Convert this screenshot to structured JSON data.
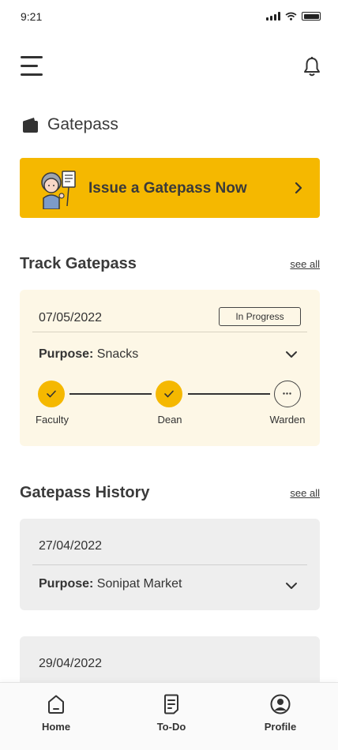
{
  "status_bar": {
    "time": "9:21"
  },
  "page": {
    "title": "Gatepass"
  },
  "issue_banner": {
    "label": "Issue a Gatepass Now"
  },
  "track": {
    "heading": "Track Gatepass",
    "see_all": "see all",
    "card": {
      "date": "07/05/2022",
      "status": "In Progress",
      "purpose_label": "Purpose:",
      "purpose_value": "Snacks",
      "steps": [
        {
          "label": "Faculty",
          "state": "done"
        },
        {
          "label": "Dean",
          "state": "done"
        },
        {
          "label": "Warden",
          "state": "pending"
        }
      ]
    }
  },
  "history": {
    "heading": "Gatepass History",
    "see_all": "see all",
    "items": [
      {
        "date": "27/04/2022",
        "purpose_label": "Purpose:",
        "purpose_value": "Sonipat Market"
      },
      {
        "date": "29/04/2022"
      }
    ]
  },
  "bottom_nav": {
    "items": [
      {
        "label": "Home",
        "icon": "home-icon"
      },
      {
        "label": "To-Do",
        "icon": "todo-icon"
      },
      {
        "label": "Profile",
        "icon": "profile-icon"
      }
    ]
  },
  "colors": {
    "accent": "#f5b800",
    "track_card_bg": "#fdf7e6",
    "history_card_bg": "#eeeeee"
  }
}
